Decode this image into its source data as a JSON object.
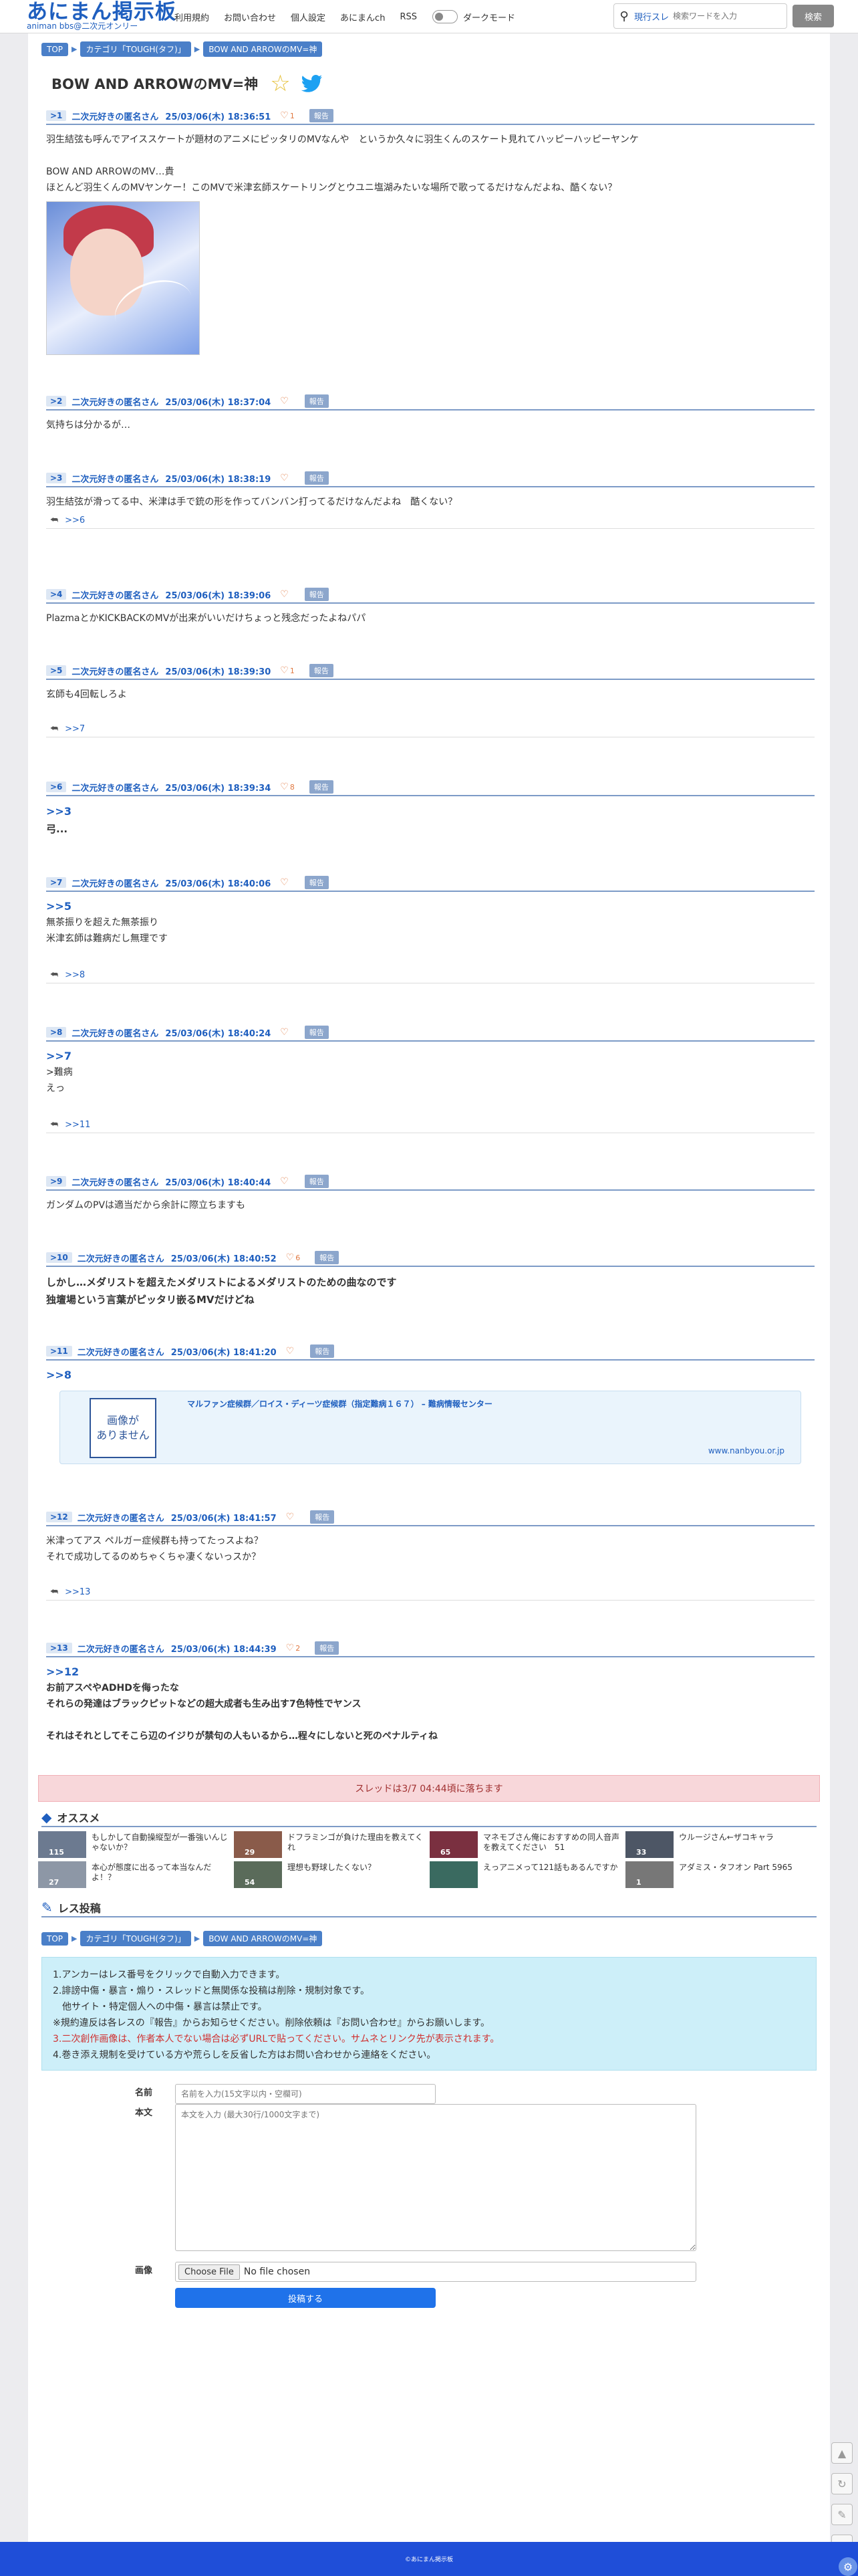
{
  "header": {
    "logo": "あにまん掲示板",
    "logo_sub": "animan bbs@二次元オンリー",
    "nav": [
      "利用規約",
      "お問い合わせ",
      "個人設定",
      "あにまんch",
      "RSS"
    ],
    "dark_mode_label": "ダークモード",
    "search_mode": "現行スレ",
    "search_placeholder": "検索ワードを入力",
    "search_button": "検索"
  },
  "breadcrumb": [
    "TOP",
    "カテゴリ「TOUGH(タフ)」",
    "BOW AND ARROWのMV=神"
  ],
  "thread_title": "BOW AND ARROWのMV=神",
  "report_label": "報告",
  "posts": [
    {
      "no": ">1",
      "name": "二次元好きの匿名さん",
      "date": "25/03/06(木) 18:36:51",
      "likes": "1",
      "lines": [
        "羽生結弦も呼んでアイススケートが題材のアニメにピッタリのMVなんや　というか久々に羽生くんのスケート見れてハッピーハッピーヤンケ",
        "",
        "BOW AND ARROWのMV…貴",
        "ほとんど羽生くんのMVヤンケー！このMVで米津玄師スケートリングとウユニ塩湖みたいな場所で歌ってるだけなんだよね、酷くない？"
      ]
    },
    {
      "no": ">2",
      "name": "二次元好きの匿名さん",
      "date": "25/03/06(木) 18:37:04",
      "likes": "",
      "lines": [
        "気持ちは分かるが…"
      ]
    },
    {
      "no": ">3",
      "name": "二次元好きの匿名さん",
      "date": "25/03/06(木) 18:38:19",
      "likes": "",
      "lines": [
        "羽生結弦が滑ってる中、米津は手で銃の形を作ってバンバン打ってるだけなんだよね　酷くない？"
      ],
      "replies": ">>6"
    },
    {
      "no": ">4",
      "name": "二次元好きの匿名さん",
      "date": "25/03/06(木) 18:39:06",
      "likes": "",
      "lines": [
        "PlazmaとかKICKBACKのMVが出来がいいだけちょっと残念だったよねパパ"
      ]
    },
    {
      "no": ">5",
      "name": "二次元好きの匿名さん",
      "date": "25/03/06(木) 18:39:30",
      "likes": "1",
      "lines": [
        "玄師も4回転しろよ"
      ],
      "replies": ">>7"
    },
    {
      "no": ">6",
      "name": "二次元好きの匿名さん",
      "date": "25/03/06(木) 18:39:34",
      "likes": "8",
      "anchor": ">>3",
      "lines": [
        "弓..."
      ]
    },
    {
      "no": ">7",
      "name": "二次元好きの匿名さん",
      "date": "25/03/06(木) 18:40:06",
      "likes": "",
      "anchor": ">>5",
      "lines": [
        "無茶振りを超えた無茶振り",
        "米津玄師は難病だし無理です"
      ],
      "replies": ">>8"
    },
    {
      "no": ">8",
      "name": "二次元好きの匿名さん",
      "date": "25/03/06(木) 18:40:24",
      "likes": "",
      "anchor": ">>7",
      "lines": [
        ">難病",
        "えっ"
      ],
      "replies": ">>11"
    },
    {
      "no": ">9",
      "name": "二次元好きの匿名さん",
      "date": "25/03/06(木) 18:40:44",
      "likes": "",
      "lines": [
        "ガンダムのPVは適当だから余計に際立ちますも"
      ]
    },
    {
      "no": ">10",
      "name": "二次元好きの匿名さん",
      "date": "25/03/06(木) 18:40:52",
      "likes": "6",
      "lines": [
        "しかし…メダリストを超えたメダリストによるメダリストのための曲なのです",
        "独壇場という言葉がピッタリ嵌るMVだけどね"
      ]
    },
    {
      "no": ">11",
      "name": "二次元好きの匿名さん",
      "date": "25/03/06(木) 18:41:20",
      "likes": "",
      "anchor": ">>8",
      "lines": []
    },
    {
      "no": ">12",
      "name": "二次元好きの匿名さん",
      "date": "25/03/06(木) 18:41:57",
      "likes": "",
      "lines": [
        "米津ってアス ペルガー症候群も持ってたっスよね？",
        "それで成功してるのめちゃくちゃ凄くないっスか？"
      ],
      "replies": ">>13"
    },
    {
      "no": ">13",
      "name": "二次元好きの匿名さん",
      "date": "25/03/06(木) 18:44:39",
      "likes": "2",
      "anchor": ">>12",
      "lines": [
        "お前アスペやADHDを侮ったな",
        "それらの発達はブラックピットなどの超大成者も生み出す7色特性でヤンス",
        "",
        "それはそれとしてそこら辺のイジりが禁句の人もいるから…程々にしないと死のペナルティね"
      ]
    }
  ],
  "link_card": {
    "noimage": "画像が\nありません",
    "title": "マルファン症候群／ロイス・ディーツ症候群（指定難病１６７） – 難病情報センター",
    "url": "www.nanbyou.or.jp"
  },
  "notice": "スレッドは3/7 04:44頃に落ちます",
  "recommend_title": "オススメ",
  "recommend": [
    {
      "title": "もしかして自動操縦型が一番強いんじゃないか？",
      "count": "115",
      "color": "#6c7a90"
    },
    {
      "title": "ドフラミンゴが負けた理由を教えてくれ",
      "count": "29",
      "color": "#8a5b4a"
    },
    {
      "title": "マネモブさん俺におすすめの同人音声を教えてください　51",
      "count": "65",
      "color": "#7a3040"
    },
    {
      "title": "ウルージさん←ザコキャラ",
      "count": "33",
      "color": "#4d5665"
    },
    {
      "title": "本心が態度に出るって本当なんだよ！？",
      "count": "27",
      "color": "#8d97a6"
    },
    {
      "title": "理想も野球したくない？",
      "count": "54",
      "color": "#5a6b5a"
    },
    {
      "title": "えっアニメって121話もあるんですか",
      "count": "",
      "color": "#3a6a60"
    },
    {
      "title": "アダミス・タフオン Part 5965",
      "count": "1",
      "color": "#777777"
    }
  ],
  "post_section_title": "レス投稿",
  "rules": [
    {
      "text": "1.アンカーはレス番号をクリックで自動入力できます。",
      "red": false
    },
    {
      "text": "2.誹謗中傷・暴言・煽り・スレッドと無関係な投稿は削除・規制対象です。",
      "red": false
    },
    {
      "text": "　他サイト・特定個人への中傷・暴言は禁止です。",
      "red": false
    },
    {
      "text": "※規約違反は各レスの『報告』からお知らせください。削除依頼は『お問い合わせ』からお願いします。",
      "red": false
    },
    {
      "text": "3.二次創作画像は、作者本人でない場合は必ずURLで貼ってください。サムネとリンク先が表示されます。",
      "red": true
    },
    {
      "text": "4.巻き添え規制を受けている方や荒らしを反省した方はお問い合わせから連絡をください。",
      "red": false
    }
  ],
  "form": {
    "name_label": "名前",
    "name_placeholder": "名前を入力(15文字以内・空欄可)",
    "body_label": "本文",
    "body_placeholder": "本文を入力 (最大30行/1000文字まで)",
    "image_label": "画像",
    "file_button": "Choose File",
    "file_text": "No file chosen",
    "submit": "投稿する"
  },
  "footer": "©あにまん掲示板",
  "colors": {
    "accent": "#1f5fbf",
    "footer": "#1f4ed8",
    "notice_bg": "#f8d7da",
    "info_bg": "#cdeff9"
  }
}
